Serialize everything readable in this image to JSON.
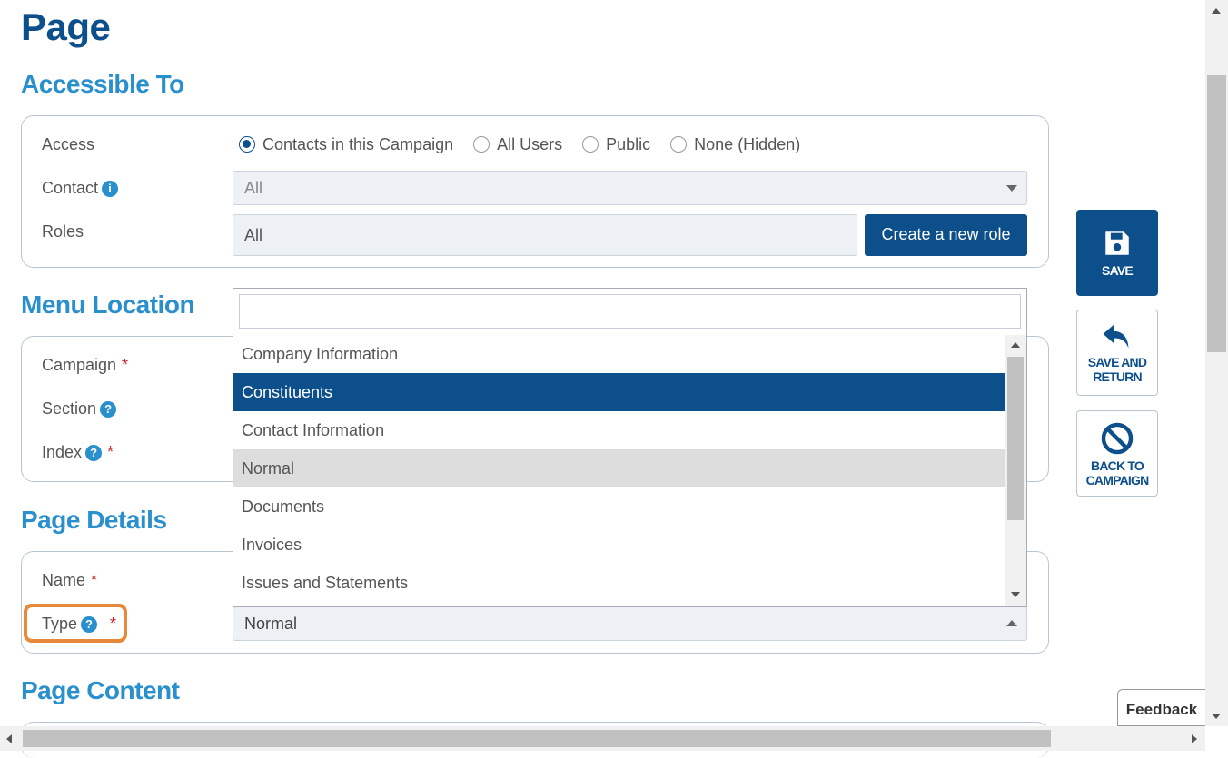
{
  "page": {
    "title": "Page"
  },
  "accessible_to": {
    "title": "Accessible To",
    "access_label": "Access",
    "access_options": [
      "Contacts in this Campaign",
      "All Users",
      "Public",
      "None (Hidden)"
    ],
    "access_selected": "Contacts in this Campaign",
    "contact_label": "Contact",
    "contact_value": "All",
    "roles_label": "Roles",
    "roles_value": "All",
    "create_role_label": "Create a new role"
  },
  "menu_location": {
    "title": "Menu Location",
    "campaign_label": "Campaign",
    "section_label": "Section",
    "index_label": "Index"
  },
  "page_details": {
    "title": "Page Details",
    "name_label": "Name",
    "type_label": "Type",
    "type_value": "Normal"
  },
  "page_content": {
    "title": "Page Content"
  },
  "required_mark": "*",
  "help_glyph": "?",
  "info_glyph": "i",
  "dropdown": {
    "search_value": "",
    "items": [
      "Company Information",
      "Constituents",
      "Contact Information",
      "Normal",
      "Documents",
      "Invoices",
      "Issues and Statements"
    ],
    "selected": "Constituents",
    "hovered": "Normal"
  },
  "side_actions": {
    "save_label": "SAVE",
    "save_return_label_1": "SAVE AND",
    "save_return_label_2": "RETURN",
    "back_label_1": "BACK TO",
    "back_label_2": "CAMPAIGN"
  },
  "feedback_label": "Feedback",
  "colors": {
    "primary": "#0d4f8b",
    "accent": "#2a8fcd",
    "required": "#c62828",
    "highlight": "#e8893a"
  },
  "icons": [
    "info-icon",
    "help-icon",
    "save-icon",
    "undo-arrow-icon",
    "no-entry-icon",
    "caret-down-icon"
  ]
}
